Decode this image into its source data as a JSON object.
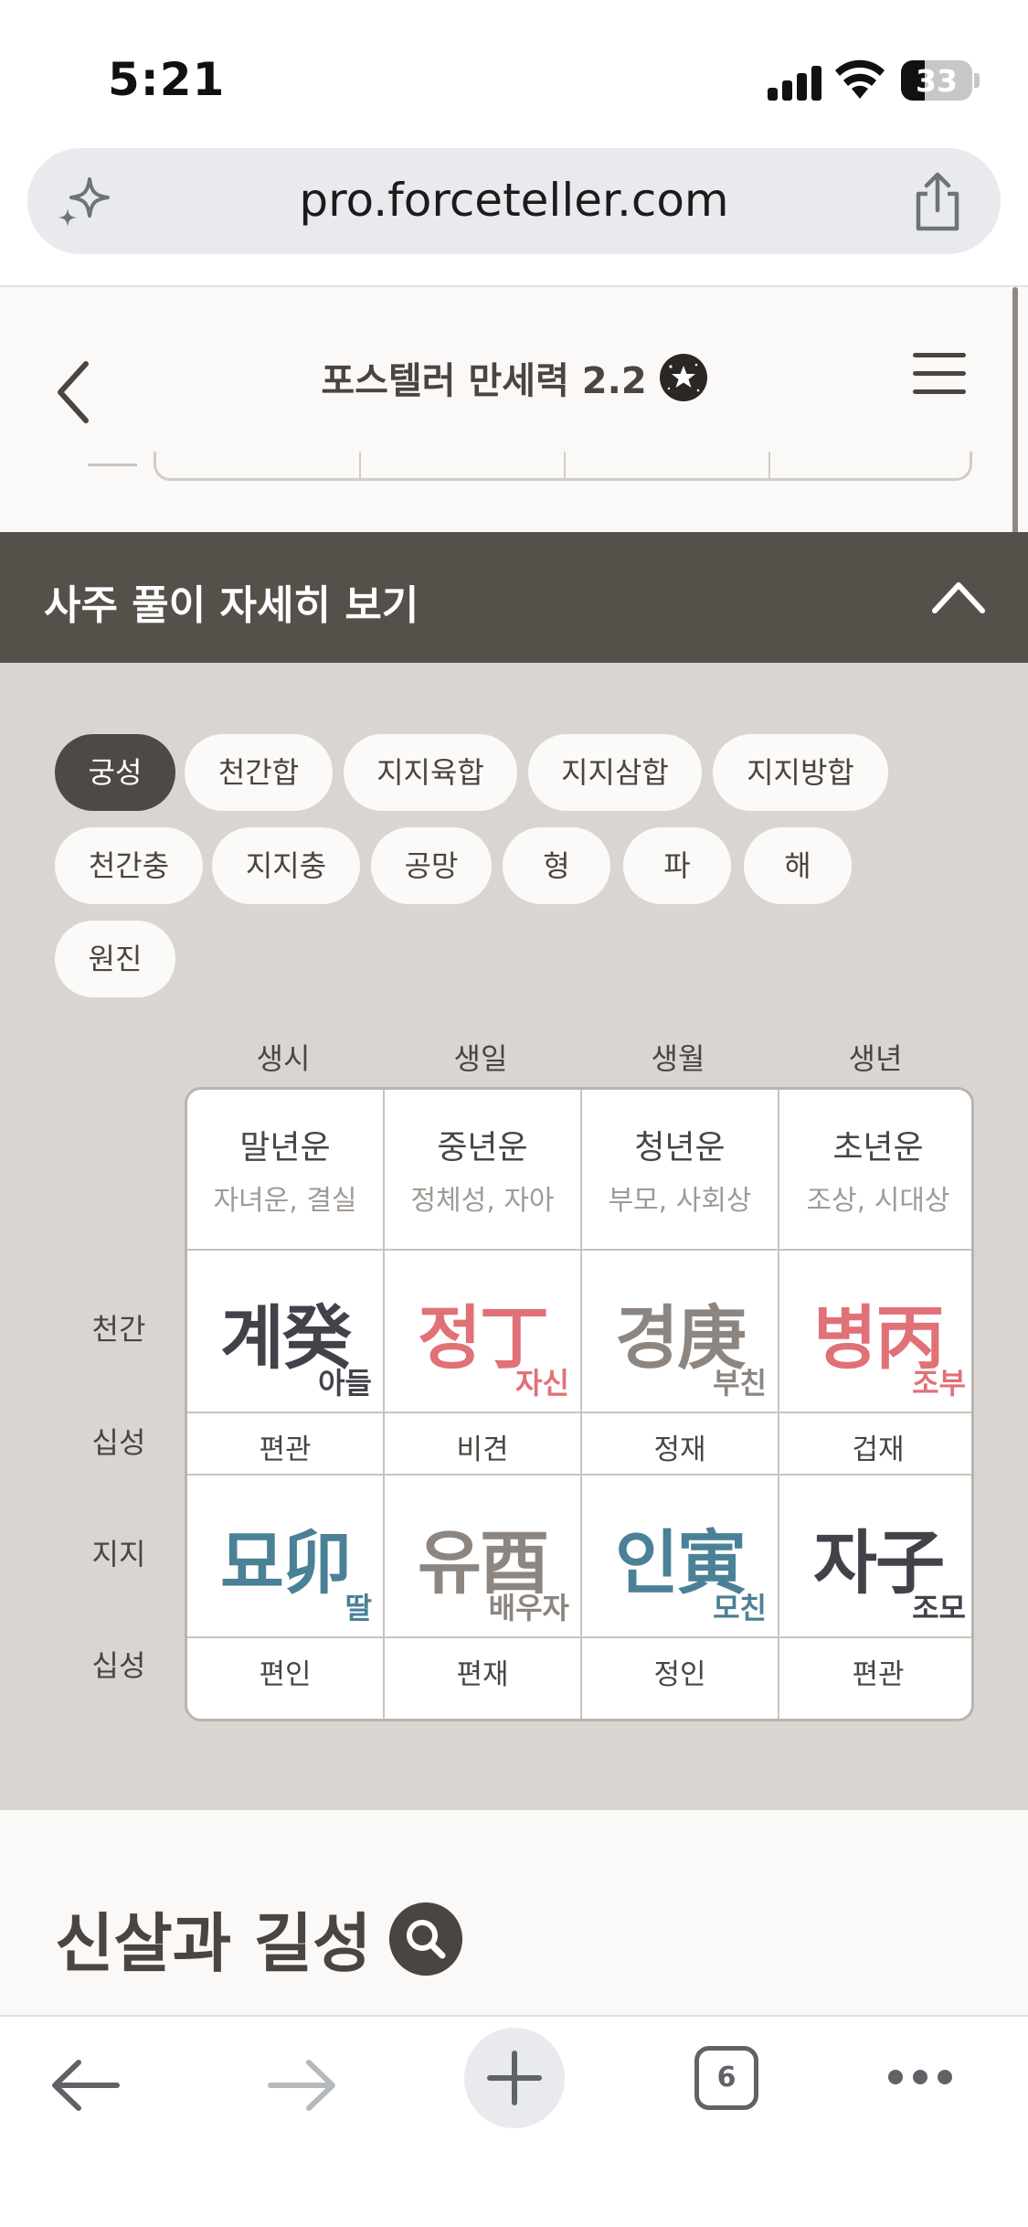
{
  "status_bar": {
    "time": "5:21",
    "battery": "33",
    "battery_level": 0.33
  },
  "browser": {
    "url": "pro.forceteller.com",
    "tab_count": "6"
  },
  "app": {
    "title": "포스텔러 만세력 2.2"
  },
  "section": {
    "title": "사주 풀이 자세히 보기"
  },
  "chips": [
    {
      "label": "궁성",
      "active": true
    },
    {
      "label": "천간합"
    },
    {
      "label": "지지육합"
    },
    {
      "label": "지지삼합"
    },
    {
      "label": "지지방합"
    },
    {
      "label": "천간충"
    },
    {
      "label": "지지충"
    },
    {
      "label": "공망"
    },
    {
      "label": "형"
    },
    {
      "label": "파"
    },
    {
      "label": "해"
    },
    {
      "label": "원진"
    }
  ],
  "table": {
    "columns": [
      "생시",
      "생일",
      "생월",
      "생년"
    ],
    "row_labels": {
      "cheongan": "천간",
      "sipseong1": "십성",
      "jiji": "지지",
      "sipseong2": "십성"
    },
    "life_periods": [
      {
        "title": "말년운",
        "sub": "자녀운, 결실"
      },
      {
        "title": "중년운",
        "sub": "정체성, 자아"
      },
      {
        "title": "청년운",
        "sub": "부모, 사회상"
      },
      {
        "title": "초년운",
        "sub": "조상, 시대상"
      }
    ],
    "cheongan": [
      {
        "glyph": "계癸",
        "relation": "아들",
        "color": "#45414a"
      },
      {
        "glyph": "정丁",
        "relation": "자신",
        "color": "#e07177"
      },
      {
        "glyph": "경庚",
        "relation": "부친",
        "color": "#8d8580"
      },
      {
        "glyph": "병丙",
        "relation": "조부",
        "color": "#e07177"
      }
    ],
    "sipseong_top": [
      "편관",
      "비견",
      "정재",
      "겁재"
    ],
    "jiji": [
      {
        "glyph": "묘卯",
        "relation": "딸",
        "color": "#4a8196"
      },
      {
        "glyph": "유酉",
        "relation": "배우자",
        "color": "#8d8580"
      },
      {
        "glyph": "인寅",
        "relation": "모친",
        "color": "#4a8196"
      },
      {
        "glyph": "자子",
        "relation": "조모",
        "color": "#45414a"
      }
    ],
    "sipseong_bottom": [
      "편인",
      "편재",
      "정인",
      "편관"
    ]
  },
  "shinsal": {
    "title": "신살과 길성"
  },
  "icons": [
    "sparkle-icon",
    "share-icon",
    "back-chevron-icon",
    "star-badge-icon",
    "menu-icon",
    "chevron-up-icon",
    "search-icon",
    "arrow-left-icon",
    "arrow-right-icon",
    "plus-icon",
    "tabs-icon",
    "more-icon"
  ]
}
